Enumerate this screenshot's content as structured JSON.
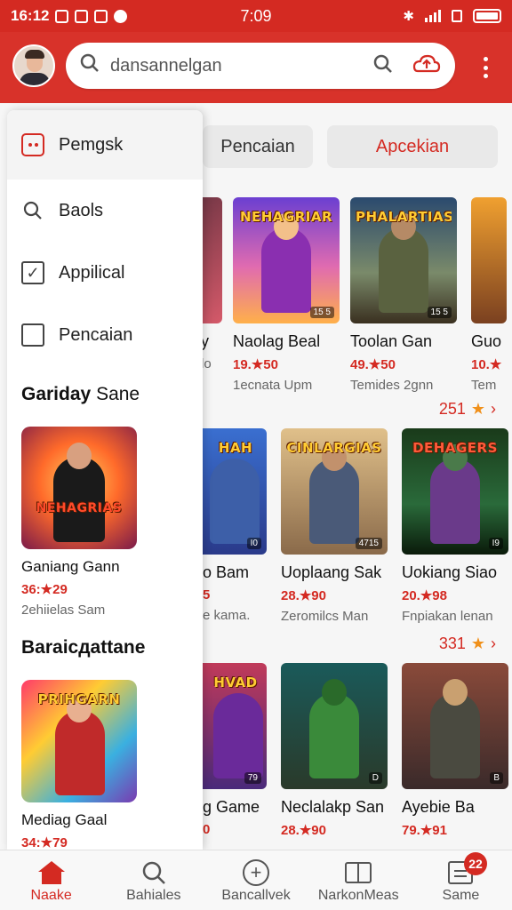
{
  "status_bar": {
    "time_left": "16:12",
    "time_center": "7:09"
  },
  "top_bar": {
    "search_value": "dansannelgan",
    "overflow_icon": "more-vert-icon"
  },
  "chips": {
    "chip1": "Pencaian",
    "chip2": "Apcekian"
  },
  "drawer": {
    "items": [
      {
        "label": "Pemgsk",
        "icon": "app-icon"
      },
      {
        "label": "Baols",
        "icon": "search-icon"
      },
      {
        "label": "Appilical",
        "icon": "checkbox-checked-icon"
      },
      {
        "label": "Pencaian",
        "icon": "checkbox-icon"
      }
    ],
    "section1": {
      "bold": "Gariday",
      "normal": "Sane"
    },
    "game1": {
      "banner": "NEHAGRIAS",
      "title": "Ganiang Gann",
      "rating": "36:★29",
      "sub": "2ehiielas Sam"
    },
    "section2": "Baraicдattane",
    "game2": {
      "banner": "PRIHGARN",
      "title": "Mediag Gaal",
      "rating": "34:★79"
    }
  },
  "grid": {
    "row1": [
      {
        "title": "y",
        "rating": "",
        "sub": "lo",
        "banner": "",
        "tag": ""
      },
      {
        "title": "Naolag Beal",
        "rating": "19.★50",
        "sub": "1ecnata Upm",
        "banner": "NEHAGRIAR",
        "tag": "15 5"
      },
      {
        "title": "Toolan Gan",
        "rating": "49.★50",
        "sub": "Temides 2gnn",
        "banner": "PHALARTIAS",
        "tag": "15 5"
      },
      {
        "title": "Guo",
        "rating": "10.★",
        "sub": "Tem",
        "banner": "",
        "tag": ""
      }
    ],
    "count2": "251",
    "row2": [
      {
        "title": "o Bam",
        "rating": "5",
        "sub": "e kama.",
        "banner": "HAH",
        "tag": "I0"
      },
      {
        "title": "Uoplaang Sak",
        "rating": "28.★90",
        "sub": "Zeromilcs Man",
        "banner": "CINLARGIAS",
        "tag": "4715"
      },
      {
        "title": "Uokiang Siao",
        "rating": "20.★98",
        "sub": "Fnpiakan lenan",
        "banner": "DEHAGERS",
        "tag": "I9"
      }
    ],
    "count3": "331",
    "row3": [
      {
        "title": "g Game",
        "rating": "0",
        "sub": "",
        "banner": "HVAD",
        "tag": "79"
      },
      {
        "title": "Neclalakp San",
        "rating": "28.★90",
        "sub": "",
        "banner": "",
        "tag": "D"
      },
      {
        "title": "Ayebie Ba",
        "rating": "79.★91",
        "sub": "",
        "banner": "",
        "tag": "B"
      }
    ]
  },
  "bottom_nav": {
    "items": [
      {
        "label": "Naake",
        "icon": "home-icon"
      },
      {
        "label": "Bahiales",
        "icon": "search-icon"
      },
      {
        "label": "Bancallvek",
        "icon": "add-circle-icon"
      },
      {
        "label": "NarkonMeas",
        "icon": "book-icon"
      },
      {
        "label": "Same",
        "icon": "news-icon",
        "badge": "22"
      }
    ]
  },
  "colors": {
    "brand_red": "#d42a22",
    "star_orange": "#f0901a"
  }
}
